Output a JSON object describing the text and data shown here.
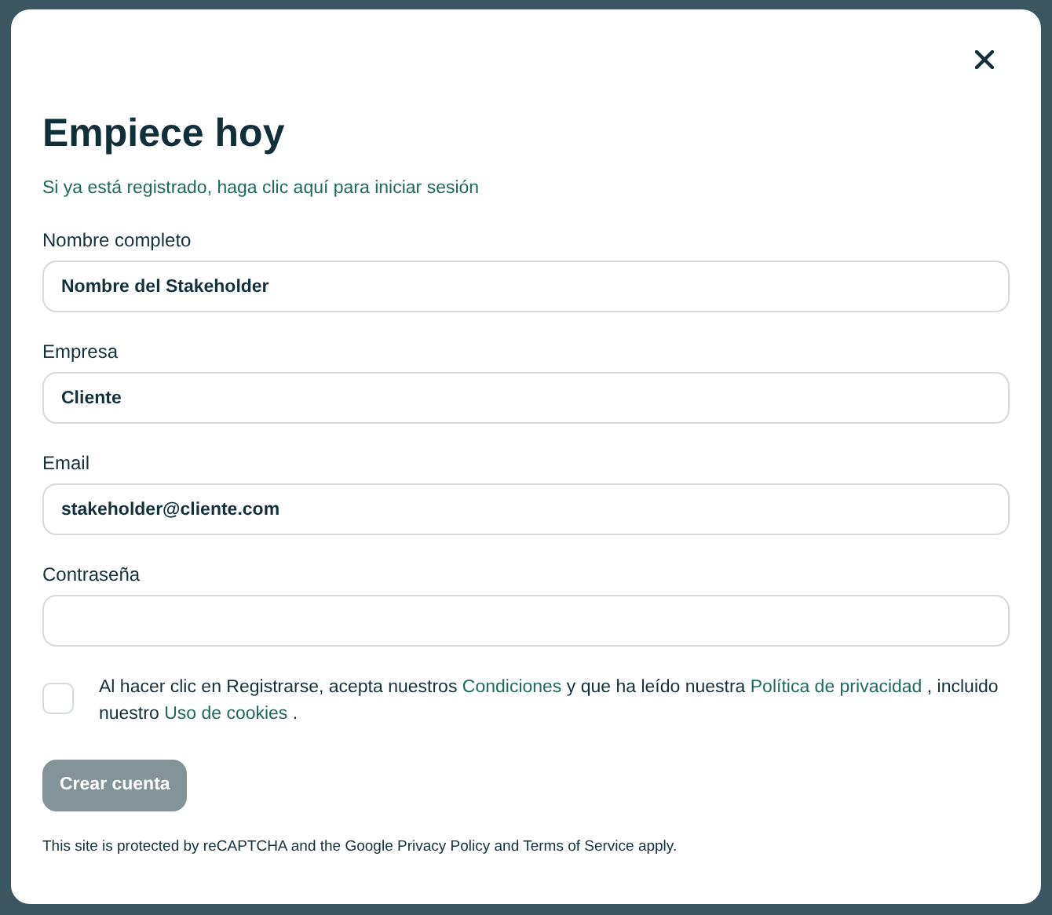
{
  "title": "Empiece hoy",
  "login_link": "Si ya está registrado, haga clic aquí para iniciar sesión",
  "fields": [
    {
      "label": "Nombre completo",
      "value": "Nombre del Stakeholder"
    },
    {
      "label": "Empresa",
      "value": "Cliente"
    },
    {
      "label": "Email",
      "value": "stakeholder@cliente.com"
    },
    {
      "label": "Contraseña"
    }
  ],
  "consent": {
    "checked": false,
    "parts": [
      {
        "text": "Al hacer clic en Registrarse, acepta nuestros ",
        "link": false
      },
      {
        "text": "Condiciones",
        "link": true
      },
      {
        "text": " y que ha leído nuestra ",
        "link": false
      },
      {
        "text": "Política de privacidad",
        "link": true
      },
      {
        "text": " , incluido nuestro ",
        "link": false
      },
      {
        "text": "Uso de cookies",
        "link": true
      },
      {
        "text": " .",
        "link": false
      }
    ]
  },
  "submit": {
    "label": "Crear cuenta",
    "disabled": true
  },
  "footer": "This site is protected by reCAPTCHA and the Google Privacy Policy and Terms of Service apply."
}
